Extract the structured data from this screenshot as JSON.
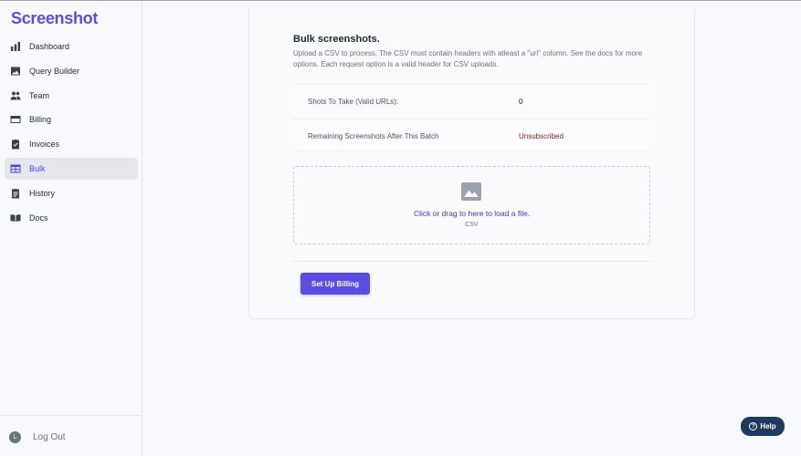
{
  "app": {
    "logo": "Screenshot"
  },
  "sidebar": {
    "items": [
      {
        "label": "Dashboard",
        "icon": "bar-chart-icon",
        "active": false
      },
      {
        "label": "Query Builder",
        "icon": "image-icon",
        "active": false
      },
      {
        "label": "Team",
        "icon": "users-icon",
        "active": false
      },
      {
        "label": "Billing",
        "icon": "credit-card-icon",
        "active": false
      },
      {
        "label": "Invoices",
        "icon": "clipboard-check-icon",
        "active": false
      },
      {
        "label": "Bulk",
        "icon": "table-icon",
        "active": true
      },
      {
        "label": "History",
        "icon": "clipboard-list-icon",
        "active": false
      },
      {
        "label": "Docs",
        "icon": "book-icon",
        "active": false
      }
    ],
    "logout": {
      "avatar": "L",
      "label": "Log Out"
    }
  },
  "bulk": {
    "title": "Bulk screenshots.",
    "description": "Upload a CSV to process. The CSV must contain headers with atleast a \"url\" column. See the docs for more options. Each request option is a valid header for CSV uploads.",
    "stats": [
      {
        "label": "Shots To Take (Valid URLs):",
        "value": "0"
      },
      {
        "label": "Remaining Screenshots After This Batch",
        "value": "Unsubscribed"
      }
    ],
    "dropzone": {
      "text": "Click or drag to here to load a file.",
      "subtext": "CSV"
    },
    "billing_button": "Set Up Billing"
  },
  "help": {
    "label": "Help"
  },
  "colors": {
    "accent": "#5b4de2",
    "warning": "#7f1d1d",
    "help_bg": "#1e3a5f"
  }
}
